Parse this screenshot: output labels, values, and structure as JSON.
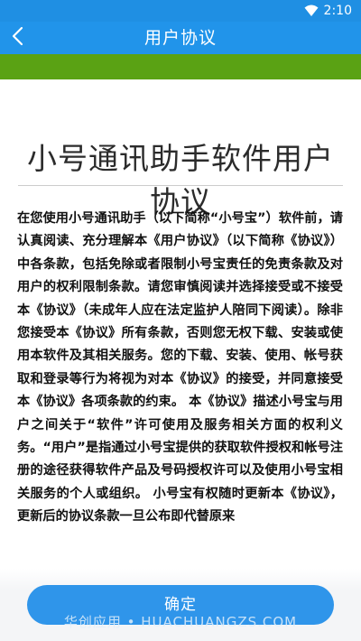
{
  "status_bar": {
    "time": "2:10",
    "icons": [
      "wifi-icon"
    ]
  },
  "app_bar": {
    "title": "用户协议",
    "back_icon": "chevron-left-icon"
  },
  "document": {
    "title": "小号通讯助手软件用户协议",
    "body": "在您使用小号通讯助手（以下简称“小号宝”）软件前，请认真阅读、充分理解本《用户协议》（以下简称《协议》）中各条款，包括免除或者限制小号宝责任的免责条款及对用户的权利限制条款。请您审慎阅读并选择接受或不接受本《协议》（未成年人应在法定监护人陪同下阅读）。除非您接受本《协议》所有条款，否则您无权下载、安装或使用本软件及其相关服务。您的下载、安装、使用、帐号获取和登录等行为将视为对本《协议》的接受，并同意接受本《协议》各项条款的约束。 本《协议》描述小号宝与用户之间关于“软件”许可使用及服务相关方面的权利义务。“用户”是指通过小号宝提供的获取软件授权和帐号注册的途径获得软件产品及号码授权许可以及使用小号宝相关服务的个人或组织。 小号宝有权随时更新本《协议》，更新后的协议条款一旦公布即代替原来"
  },
  "footer": {
    "confirm_label": "确定",
    "watermark": "华创应用 • HUACHUANGZS.COM"
  },
  "colors": {
    "status_bar": "#1f8fe3",
    "app_bar": "#2194ea",
    "green_band": "#5aa214",
    "button": "#2f95ea"
  }
}
